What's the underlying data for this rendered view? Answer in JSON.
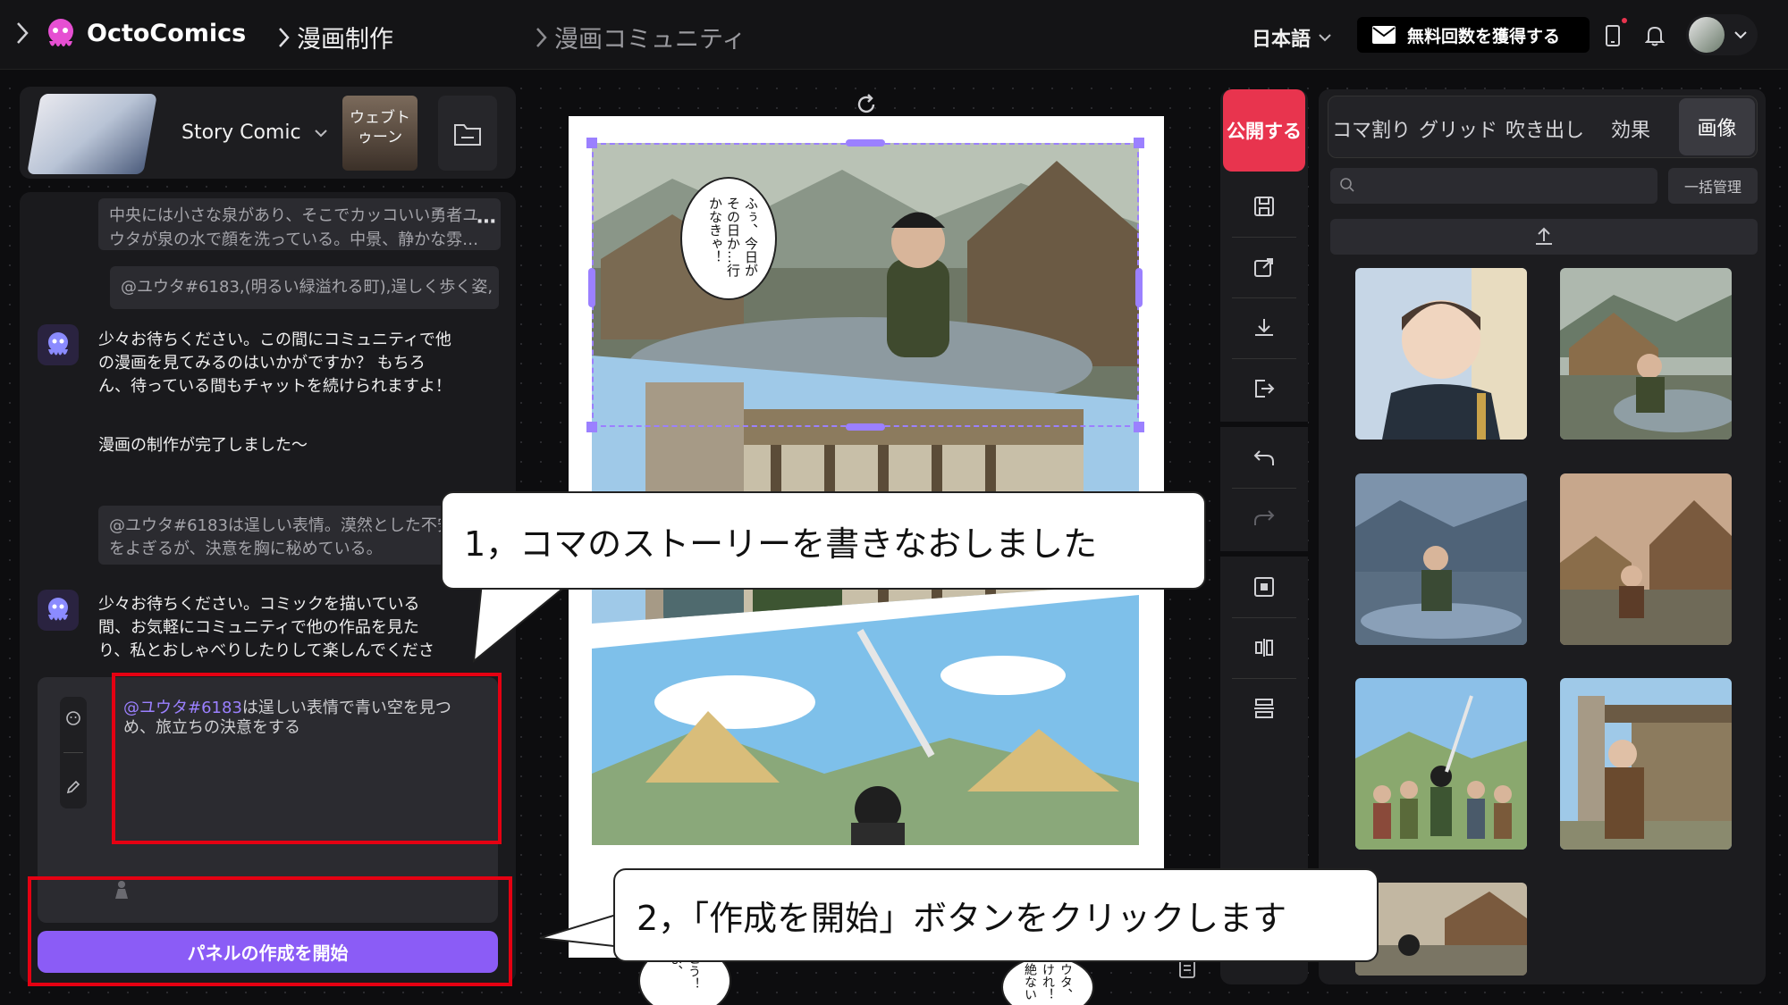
{
  "topbar": {
    "logo": "OctoComics",
    "nav": [
      "漫画制作",
      "漫画コミュニティ"
    ],
    "language": "日本語",
    "earn_button": "無料回数を獲得する"
  },
  "left": {
    "story_mode": "Story Comic",
    "character_thumb_label": "ウェブトゥーン",
    "messages": {
      "user1": "中央には小さな泉があり、そこでカッコいい勇者ユウタが泉の水で顔を洗っている。中景、静かな雰…",
      "user2": "@ユウタ#6183,(明るい緑溢れる町),逞しく歩く姿,",
      "bot1": "少々お待ちください。この間にコミュニティで他の漫画を見てみるのはいかがですか？ もちろん、待っている間もチャットを続けられますよ！",
      "bot1_done": "漫画の制作が完了しました～",
      "user3": "@ユウタ#6183は逞しい表情。漠然とした不安が胸をよぎるが、決意を胸に秘めている。",
      "bot2": "少々お待ちください。コミックを描いている間、お気軽にコミュニティで他の作品を見たり、私とおしゃべりしたりして楽しんでくださ"
    },
    "input": {
      "mention": "@ユウタ#6183",
      "text": "は逞しい表情で青い空を見つめ、旅立ちの決意をする"
    },
    "start_button": "パネルの作成を開始"
  },
  "canvas": {
    "speech_bubble_1": "ふぅ、今日がその日か…行かなきゃ！",
    "speech_bubble_bottom_left": "こう！よ、",
    "speech_bubble_bottom_right": "ウタ、けれ！絶ない"
  },
  "toolbar": {
    "publish": "公開する"
  },
  "gallery": {
    "tabs": [
      "コマ割り",
      "グリッド",
      "吹き出し",
      "効果",
      "画像"
    ],
    "active_tab": "画像",
    "search_placeholder": "",
    "bulk_manage": "一括管理"
  },
  "callouts": {
    "step1": "1，コマのストーリーを書きなおしました",
    "step2": "2，「作成を開始」ボタンをクリックします"
  },
  "colors": {
    "accent_purple": "#8b5cf6",
    "publish_red": "#e8344e",
    "annotation_red": "#e50012"
  }
}
